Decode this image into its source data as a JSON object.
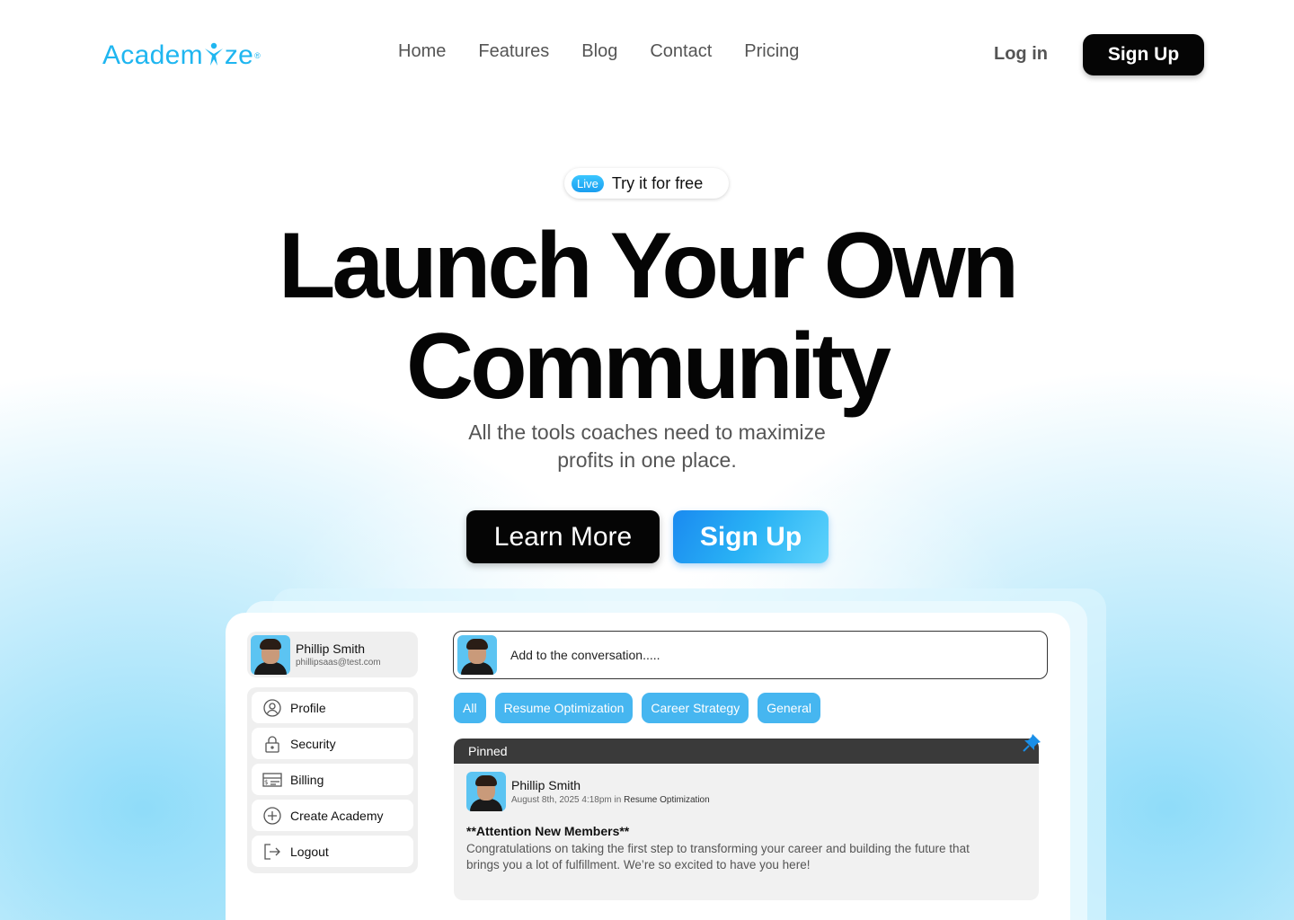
{
  "brand": {
    "logo_left": "Academ",
    "logo_right": "ze",
    "logo_mark": "®",
    "color": "#1fb6f0"
  },
  "nav": {
    "items": [
      "Home",
      "Features",
      "Blog",
      "Contact",
      "Pricing"
    ]
  },
  "auth": {
    "login": "Log in",
    "signup": "Sign Up"
  },
  "hero": {
    "badge": "Live",
    "badge_text": "Try it for free",
    "title_line1": "Launch Your Own",
    "title_line2": "Community",
    "subtitle_line1": "All the tools coaches need to maximize",
    "subtitle_line2": "profits in one place.",
    "cta_primary": "Learn More",
    "cta_secondary": "Sign Up"
  },
  "app": {
    "user": {
      "name": "Phillip Smith",
      "email": "phillipsaas@test.com"
    },
    "menu": [
      {
        "label": "Profile",
        "icon": "user-circle-icon"
      },
      {
        "label": "Security",
        "icon": "lock-icon"
      },
      {
        "label": "Billing",
        "icon": "billing-icon"
      },
      {
        "label": "Create Academy",
        "icon": "plus-circle-icon"
      },
      {
        "label": "Logout",
        "icon": "logout-icon"
      }
    ],
    "composer_placeholder": "Add to the conversation.....",
    "filters": [
      "All",
      "Resume Optimization",
      "Career Strategy",
      "General"
    ],
    "pinned_post": {
      "label": "Pinned",
      "author": "Phillip Smith",
      "meta_prefix": "August 8th, 2025 4:18pm in",
      "category": "Resume Optimization",
      "title": "**Attention New Members**",
      "body": "Congratulations on taking the first step to transforming your career and building the future that brings you a lot of fulfillment. We’re so excited to have you here!"
    }
  }
}
